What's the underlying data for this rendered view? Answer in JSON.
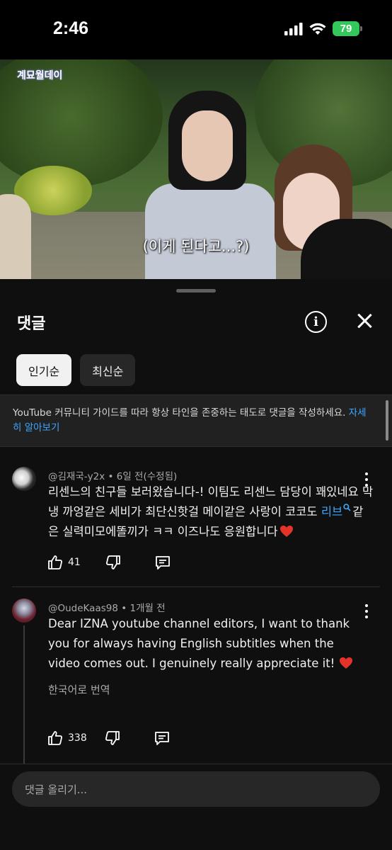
{
  "status_bar": {
    "time": "2:46",
    "battery": "79"
  },
  "video": {
    "channel_logo": "계묘월데이",
    "subtitle": "(이게 된다고...?)"
  },
  "comments_panel": {
    "title": "댓글",
    "info_icon": "info-circle-icon",
    "close_icon": "close-icon",
    "sort_chips": [
      "인기순",
      "최신순"
    ],
    "active_sort": "인기순",
    "guideline_text": "YouTube 커뮤니티 가이드를 따라 항상 타인을 존중하는 태도로 댓글을 작성하세요.",
    "guideline_link": "자세히 알아보기"
  },
  "comments": [
    {
      "author": "@김재국-y2x",
      "time": "6일 전(수정됨)",
      "text_before_link": "리센느의 친구들 보러왔습니다-!  이팀도 리센느 담당이 꽤있네요 막냉 까엉같은 세비가  최단신핫걸 메이같은 사랑이 코코도 ",
      "link": "리브",
      "text_after_link": "같은 실력미모에똘끼가 ㅋㅋ 이즈나도 응원합니다",
      "likes": "41"
    },
    {
      "author": "@OudeKaas98",
      "time": "1개월 전",
      "text": "Dear IZNA youtube channel editors, I want to thank you for always having English subtitles when the video comes out. I genuinely really appreciate it! ",
      "translate": "한국어로 번역",
      "likes": "338"
    }
  ],
  "reply_box": {
    "placeholder": "댓글 올리기..."
  },
  "colors": {
    "background": "#0f0f0f",
    "link": "#3ea6ff",
    "heart": "#e5332a",
    "battery": "#34c759"
  }
}
